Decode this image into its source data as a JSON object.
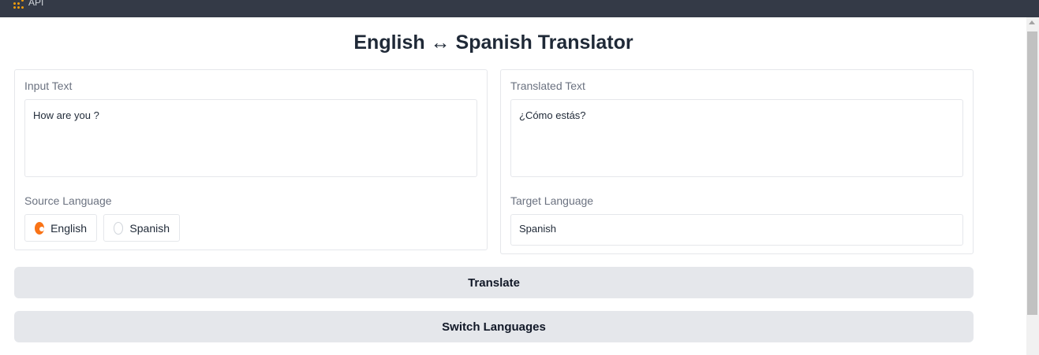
{
  "topbar": {
    "api_label": "API"
  },
  "title": "English ↔ Spanish Translator",
  "input_panel": {
    "label": "Input Text",
    "value": "How are you ?",
    "source_label": "Source Language",
    "options": [
      {
        "label": "English",
        "selected": true
      },
      {
        "label": "Spanish",
        "selected": false
      }
    ]
  },
  "output_panel": {
    "label": "Translated Text",
    "value": "¿Cómo estás?",
    "target_label": "Target Language",
    "target_value": "Spanish"
  },
  "buttons": {
    "translate": "Translate",
    "switch": "Switch Languages"
  },
  "colors": {
    "topbar": "#343a47",
    "radio_selected": "#f97316",
    "button_bg": "#e5e7eb"
  }
}
